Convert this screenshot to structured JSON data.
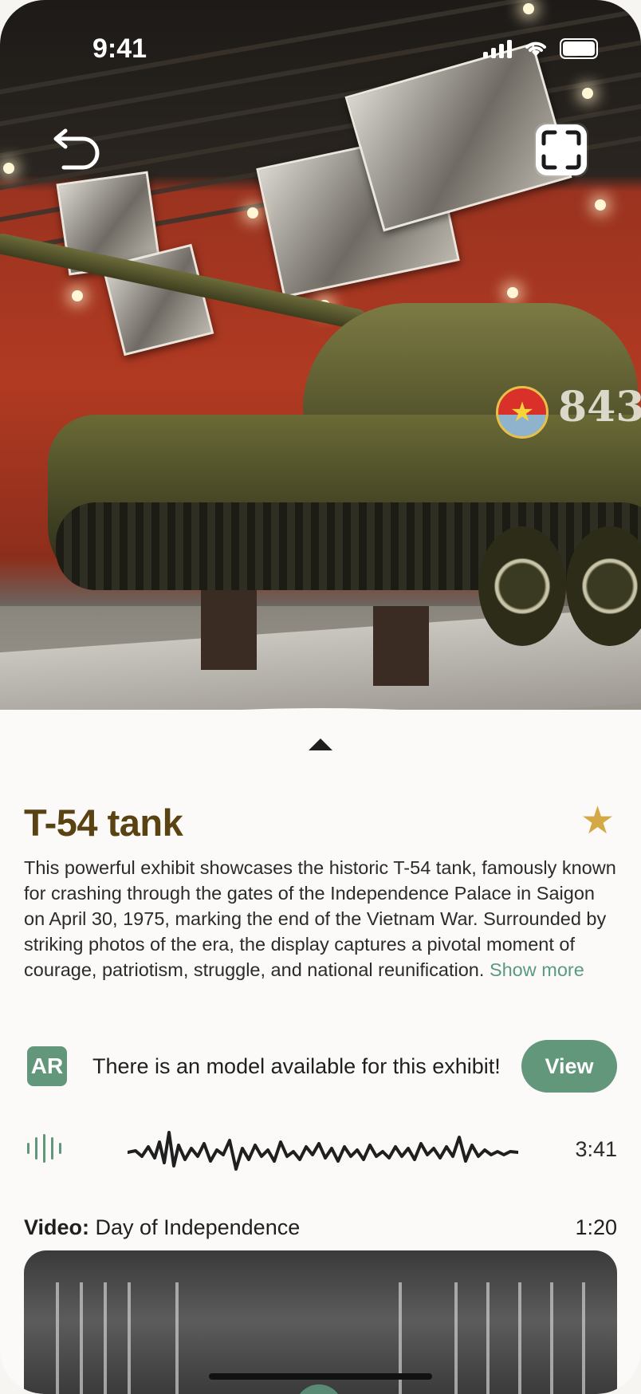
{
  "status_bar": {
    "time": "9:41"
  },
  "exhibit": {
    "title": "T-54 tank",
    "description": "This powerful exhibit showcases the historic T-54 tank, famously known for crashing through the gates of the Independence Palace in Saigon on April 30, 1975, marking the end of the Vietnam War. Surrounded by striking photos of the era, the display captures a pivotal moment of courage, patriotism, struggle, and national reunification.",
    "show_more": "Show more",
    "favorite": true
  },
  "ar": {
    "badge": "AR",
    "message": "There is an model available for this exhibit!",
    "button": "View"
  },
  "audio": {
    "duration": "3:41"
  },
  "video": {
    "label_prefix": "Video:",
    "title": "Day of Independence",
    "duration": "1:20"
  },
  "colors": {
    "accent": "#62977c",
    "title": "#5a4313",
    "star": "#d4a844",
    "link": "#5b9a7e"
  },
  "icons": [
    "back-arrow-icon",
    "scan-icon",
    "chevron-up-icon",
    "star-icon",
    "audio-wave-icon",
    "play-icon"
  ]
}
